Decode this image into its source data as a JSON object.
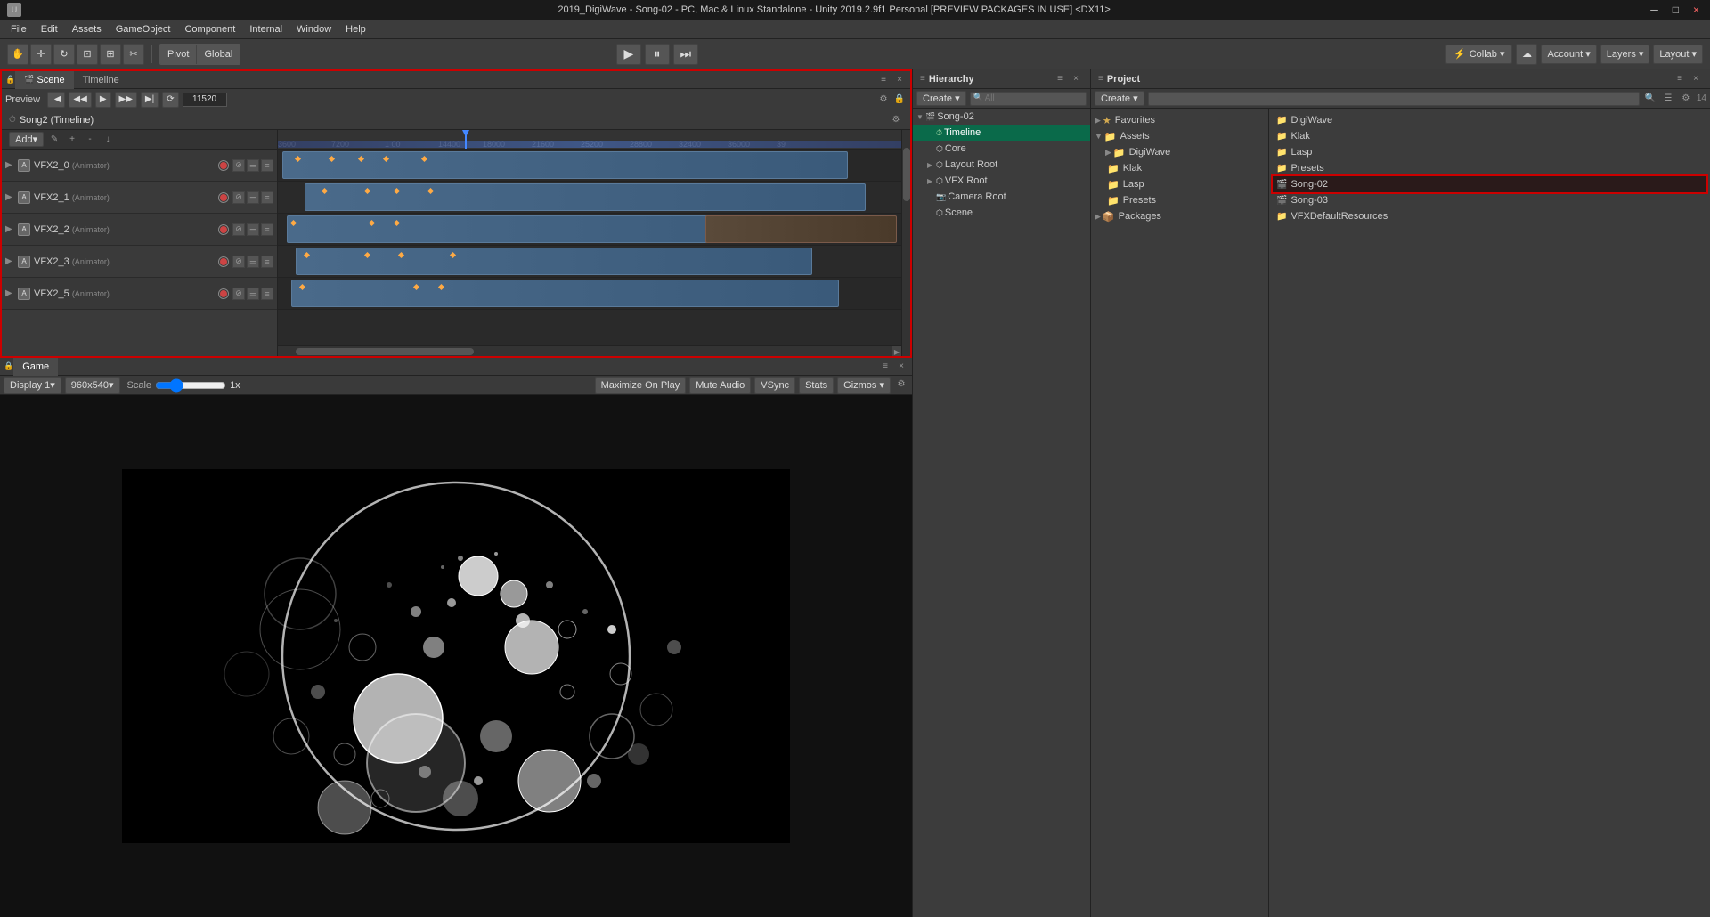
{
  "titlebar": {
    "title": "2019_DigiWave - Song-02 - PC, Mac & Linux Standalone - Unity 2019.2.9f1 Personal [PREVIEW PACKAGES IN USE] <DX11>",
    "minimize": "─",
    "maximize": "□",
    "close": "×"
  },
  "menubar": {
    "items": [
      "File",
      "Edit",
      "Assets",
      "GameObject",
      "Component",
      "Internal",
      "Window",
      "Help"
    ]
  },
  "toolbar": {
    "transform_tools": [
      "⊕",
      "⊘",
      "⇄",
      "⊡",
      "⊞",
      "✂"
    ],
    "pivot_label": "Pivot",
    "global_label": "Global",
    "play_label": "▶",
    "pause_label": "⏸",
    "step_label": "⏭",
    "collab_label": "Collab ▾",
    "cloud_label": "☁",
    "account_label": "Account ▾",
    "layers_label": "Layers ▾",
    "layout_label": "Layout ▾"
  },
  "scene_panel": {
    "tab_scene": "Scene",
    "tab_timeline": "Timeline"
  },
  "timeline": {
    "preview_label": "Preview",
    "frame_value": "11520",
    "add_label": "Add▾",
    "song2_label": "Song2 (Timeline)",
    "markers": [
      "3600",
      "7200",
      "1 00",
      "14400",
      "18000",
      "21600",
      "25200",
      "28800",
      "32400",
      "36000",
      "39"
    ],
    "tracks": [
      {
        "name": "VFX2_0",
        "type": "Animator",
        "has_recording": true
      },
      {
        "name": "VFX2_1",
        "type": "Animator",
        "has_recording": true
      },
      {
        "name": "VFX2_2",
        "type": "Animator",
        "has_recording": true
      },
      {
        "name": "VFX2_3",
        "type": "Animator",
        "has_recording": true
      },
      {
        "name": "VFX2_5",
        "type": "Animator",
        "has_recording": true
      }
    ]
  },
  "game_panel": {
    "tab_label": "Game",
    "display_label": "Display 1",
    "resolution": "960x540",
    "scale_label": "Scale",
    "scale_value": "1x",
    "maximize_on_play": "Maximize On Play",
    "mute_audio": "Mute Audio",
    "vsync": "VSync",
    "stats": "Stats",
    "gizmos": "Gizmos ▾"
  },
  "hierarchy_panel": {
    "header": "Hierarchy",
    "create_label": "Create ▾",
    "search_placeholder": "All",
    "items": [
      {
        "label": "Song-02",
        "indent": 0,
        "has_arrow": true,
        "type": "scene"
      },
      {
        "label": "Timeline",
        "indent": 1,
        "has_arrow": false,
        "type": "timeline",
        "selected": true
      },
      {
        "label": "Core",
        "indent": 1,
        "has_arrow": false,
        "type": "object"
      },
      {
        "label": "Layout Root",
        "indent": 1,
        "has_arrow": true,
        "type": "object"
      },
      {
        "label": "VFX Root",
        "indent": 1,
        "has_arrow": true,
        "type": "object"
      },
      {
        "label": "Camera Root",
        "indent": 1,
        "has_arrow": false,
        "type": "object"
      },
      {
        "label": "Scene",
        "indent": 1,
        "has_arrow": false,
        "type": "object"
      }
    ]
  },
  "project_panel": {
    "header": "Project",
    "create_label": "Create ▾",
    "search_placeholder": "",
    "favorites": {
      "label": "Favorites",
      "items": []
    },
    "assets_tree": {
      "label": "Assets",
      "items": [
        {
          "label": "DigiWave",
          "indent": 1
        },
        {
          "label": "Klak",
          "indent": 1
        },
        {
          "label": "Lasp",
          "indent": 1
        },
        {
          "label": "Presets",
          "indent": 1
        }
      ]
    },
    "packages": {
      "label": "Packages",
      "indent": 0
    },
    "asset_files": [
      {
        "label": "DigiWave",
        "type": "folder"
      },
      {
        "label": "Klak",
        "type": "folder"
      },
      {
        "label": "Lasp",
        "type": "folder"
      },
      {
        "label": "Presets",
        "type": "folder"
      },
      {
        "label": "Song-02",
        "type": "scene",
        "highlighted": true
      },
      {
        "label": "Song-03",
        "type": "scene"
      },
      {
        "label": "VFXDefaultResources",
        "type": "folder"
      }
    ]
  }
}
